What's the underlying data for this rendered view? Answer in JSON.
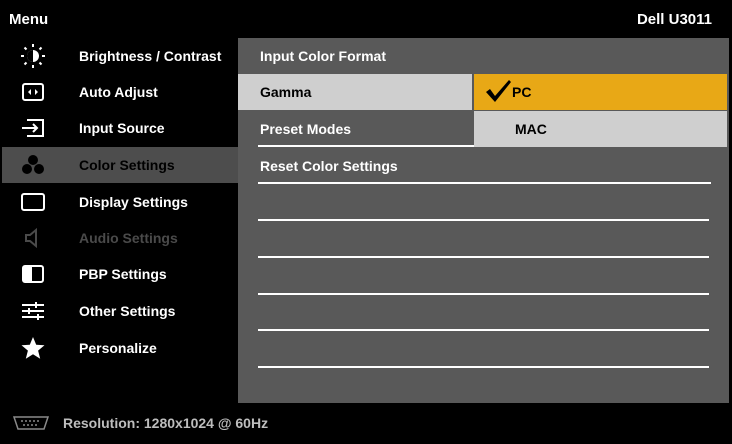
{
  "header": {
    "menu_label": "Menu",
    "model_label": "Dell U3011"
  },
  "sidebar": {
    "items": [
      {
        "label": "Brightness / Contrast",
        "icon": "brightness-icon",
        "state": "normal"
      },
      {
        "label": "Auto Adjust",
        "icon": "auto-adjust-icon",
        "state": "normal"
      },
      {
        "label": "Input Source",
        "icon": "input-source-icon",
        "state": "normal"
      },
      {
        "label": "Color Settings",
        "icon": "color-settings-icon",
        "state": "active"
      },
      {
        "label": "Display Settings",
        "icon": "display-settings-icon",
        "state": "normal"
      },
      {
        "label": "Audio Settings",
        "icon": "audio-settings-icon",
        "state": "disabled"
      },
      {
        "label": "PBP Settings",
        "icon": "pbp-settings-icon",
        "state": "normal"
      },
      {
        "label": "Other Settings",
        "icon": "other-settings-icon",
        "state": "normal"
      },
      {
        "label": "Personalize",
        "icon": "star-icon",
        "state": "normal"
      }
    ]
  },
  "panel": {
    "rows": [
      {
        "label": "Input Color Format"
      },
      {
        "label": "Gamma",
        "selected": true
      },
      {
        "label": "Preset Modes"
      },
      {
        "label": "Reset Color Settings"
      }
    ],
    "gamma_options": [
      {
        "label": "PC",
        "checked": true
      },
      {
        "label": "MAC",
        "checked": false
      }
    ]
  },
  "status": {
    "resolution_text": "Resolution: 1280x1024 @ 60Hz",
    "icon": "vga-connector-icon"
  },
  "colors": {
    "background": "#000000",
    "panel": "#595959",
    "active_item": "#4d4d4d",
    "selected_row": "#cfcfcf",
    "highlight_option": "#e8a816"
  }
}
